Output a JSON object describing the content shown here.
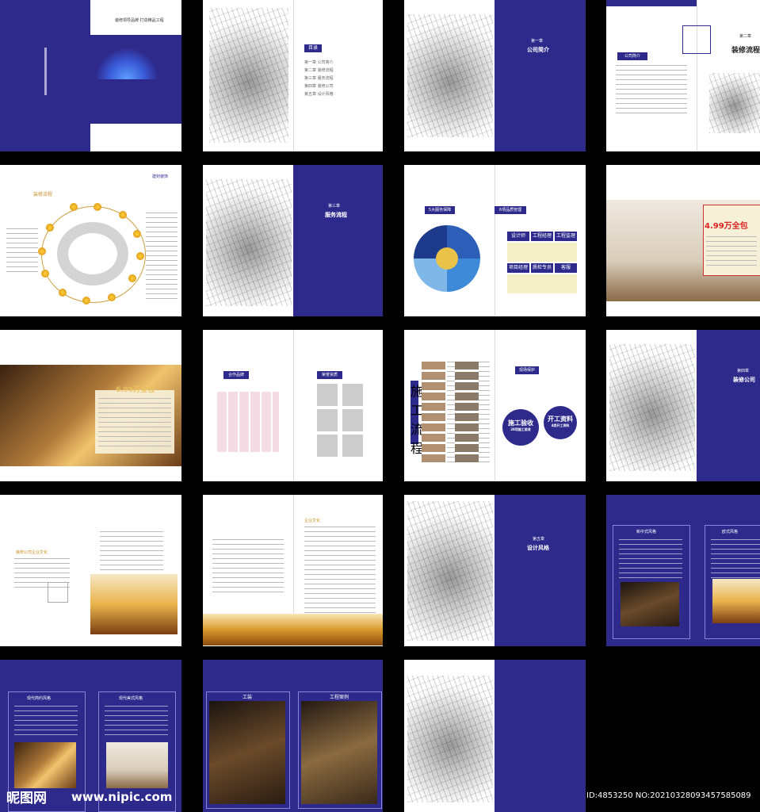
{
  "panels": {
    "p1": {
      "slogan": "装修领导品牌 打造精品工程"
    },
    "p2": {
      "toc_title": "目录",
      "toc_items": [
        "第一章 公司简介",
        "第二章 装修流程",
        "第三章 服务流程",
        "第四章 装修公司",
        "第五章 设计风格"
      ]
    },
    "p3": {
      "chapter": "第一章",
      "title": "公司简介"
    },
    "p4": {
      "chapter": "第二章",
      "title": "装修流程",
      "section": "公司简介"
    },
    "p5": {
      "header": "装修流程",
      "brand": "建材装饰"
    },
    "p6": {
      "chapter": "第三章",
      "title": "服务流程"
    },
    "p7": {
      "left_tag": "5大服务保障",
      "right_tag": "6项品质管理",
      "cells": [
        "设计师",
        "工程经理",
        "工程监理",
        "项目经理",
        "质检专员",
        "客服"
      ]
    },
    "p8": {
      "price": "4.99万全包"
    },
    "p9": {
      "price": "6.99万全包"
    },
    "p10": {
      "left_tag": "合作品牌",
      "right_tag": "荣誉资质"
    },
    "p11": {
      "left_tag": "施工流程",
      "right_tag": "现场保护",
      "badge1_main": "施工验收",
      "badge1_sub": "28项施工验收",
      "badge2_main": "开工资料",
      "badge2_sub": "4类开工资料"
    },
    "p12": {
      "chapter": "第四章",
      "title": "装修公司"
    },
    "p13": {
      "heading": "装修公司企业文化"
    },
    "p14": {
      "heading": "企业文化"
    },
    "p15": {
      "chapter": "第五章",
      "title": "设计风格"
    },
    "p16": {
      "left_tag": "新中式风格",
      "right_tag": "欧式风格"
    },
    "p17": {
      "left_tag": "现代简约风格",
      "right_tag": "现代美式风格"
    },
    "p18": {
      "left_tag": "工装",
      "right_tag": "工程案例"
    }
  },
  "watermark": {
    "site_cn": "昵图网",
    "site_url": "www.nipic.com",
    "id_text": "ID:4853250 NO:20210328093457585089"
  }
}
